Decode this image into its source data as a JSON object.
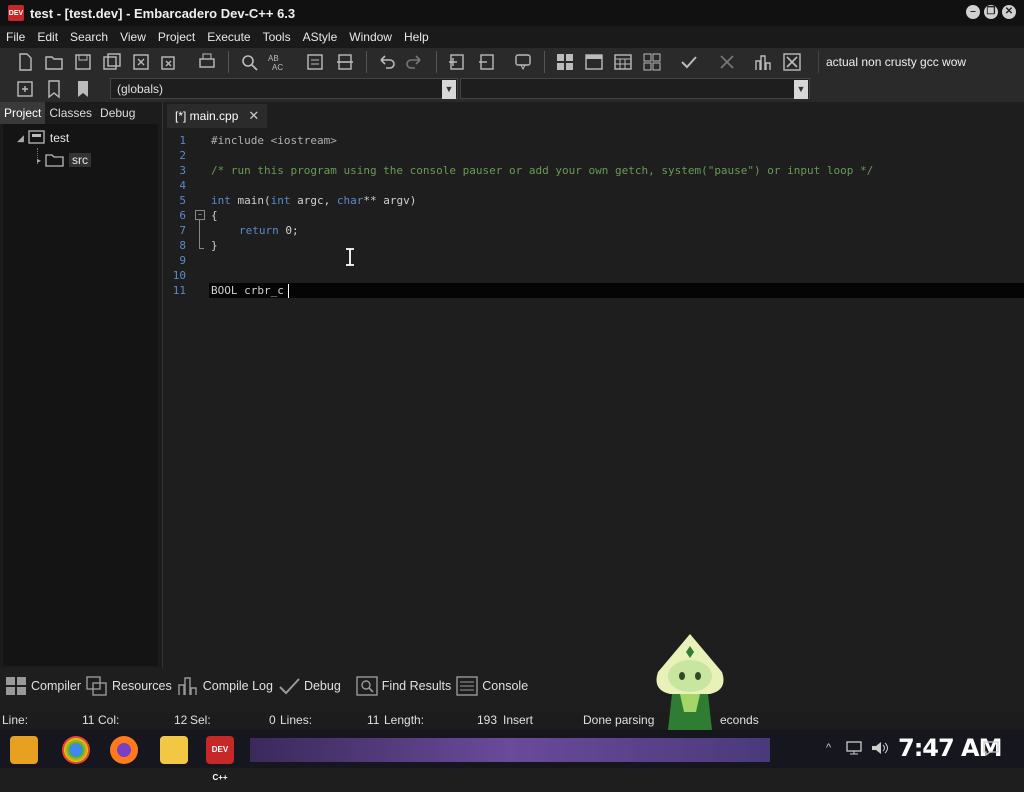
{
  "window": {
    "title": "test - [test.dev] - Embarcadero Dev-C++ 6.3",
    "app_icon_text": "DEV C++"
  },
  "menu": [
    "File",
    "Edit",
    "Search",
    "View",
    "Project",
    "Execute",
    "Tools",
    "AStyle",
    "Window",
    "Help"
  ],
  "toolbar": {
    "compiler_profile": "actual non crusty gcc wow",
    "scope_combo": "(globals)"
  },
  "left_panel": {
    "tabs": [
      "Project",
      "Classes",
      "Debug"
    ],
    "tree": {
      "project": "test",
      "folder": "src"
    }
  },
  "editor": {
    "tab_label": "[*] main.cpp",
    "line_numbers": [
      "1",
      "2",
      "3",
      "4",
      "5",
      "6",
      "7",
      "8",
      "9",
      "10",
      "11"
    ],
    "lines": {
      "l1": "#include <iostream>",
      "l3": "/* run this program using the console pauser or add your own getch, system(\"pause\") or input loop */",
      "l5_kw1": "int",
      "l5_fn": " main(",
      "l5_kw2": "int",
      "l5_mid": " argc, ",
      "l5_kw3": "char",
      "l5_end": "** argv)",
      "l6": "{",
      "l7_kw": "return",
      "l7_end": " 0;",
      "l8": "}",
      "l11": "BOOL crbr_c"
    }
  },
  "bottom_tabs": [
    "Compiler",
    "Resources",
    "Compile Log",
    "Debug",
    "Find Results",
    "Console"
  ],
  "status": {
    "line_label": "Line:",
    "line_value": "11",
    "col_label": "Col:",
    "col_value": "12",
    "sel_label": "Sel:",
    "sel_value": "0",
    "lines_label": "Lines:",
    "lines_value": "11",
    "length_label": "Length:",
    "length_value": "193",
    "mode": "Insert",
    "parse_msg_start": "Done parsing",
    "parse_msg_end": "econds"
  },
  "taskbar": {
    "clock": "7:47 AM"
  }
}
